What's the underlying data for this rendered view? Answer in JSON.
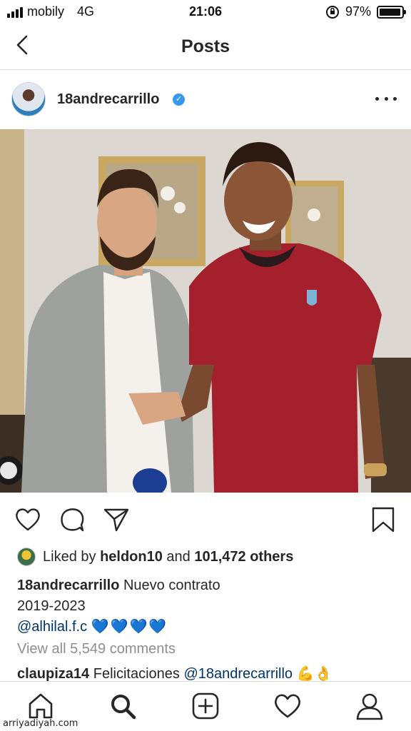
{
  "status_bar": {
    "carrier": "mobily",
    "network": "4G",
    "time": "21:06",
    "battery": "97%",
    "battery_level": 0.97
  },
  "nav": {
    "title": "Posts",
    "back_icon": "chevron-left-icon"
  },
  "post": {
    "username": "18andrecarrillo",
    "verified_icon": "verified-badge-icon",
    "more_icon": "more-horizontal-icon",
    "photo_description_icon": "photo"
  },
  "actions": {
    "like_icon": "heart-outline-icon",
    "comment_icon": "comment-bubble-icon",
    "share_icon": "paper-plane-icon",
    "save_icon": "bookmark-icon"
  },
  "likes": {
    "prefix": "Liked by ",
    "user": "heldon10",
    "middle": " and ",
    "count": "101,472 others"
  },
  "caption": {
    "author": "18andrecarrillo",
    "line1": " Nuevo contrato",
    "line2": "2019-2023",
    "mention": "@alhilal.f.c",
    "hearts": "💙💙💙💙"
  },
  "view_comments": "View all 5,549 comments",
  "comment": {
    "author": "claupiza14",
    "text": " Felicitaciones ",
    "mention": "@18andrecarrillo",
    "emoji": "💪👌"
  },
  "tabbar": {
    "items": [
      "home-icon",
      "search-icon",
      "new-post-icon",
      "activity-heart-icon",
      "profile-icon"
    ]
  },
  "watermark": "arriyadiyah.com",
  "colors": {
    "link": "#003569",
    "verified": "#3897f0",
    "hearts": "#1877f2",
    "muted": "#8e8e8e",
    "jersey": "#a3202c"
  }
}
